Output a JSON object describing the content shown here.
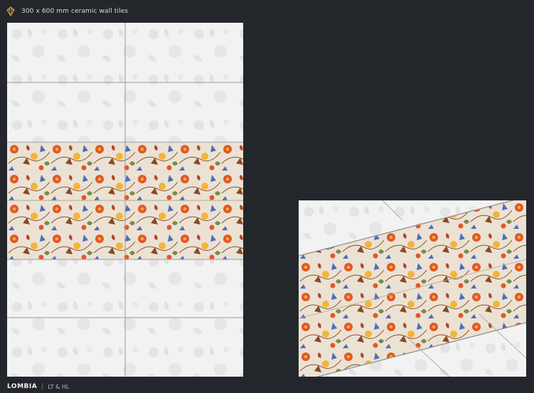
{
  "header": {
    "logo_icon": "diamond-brand-logo-icon",
    "spec_text": "300 x 600 mm ceramic wall tiles"
  },
  "footer": {
    "series_name": "LOMBIA",
    "separator": "|",
    "tile_codes": "LT & HL"
  },
  "colors": {
    "background": "#23272c",
    "light_tile": "#f2f2f2",
    "grout": "#9a9a9a",
    "decor_base": "#ebe2d4",
    "flower_orange": "#e2572a",
    "flower_yellow": "#f2b53a",
    "flower_blue": "#4d6fb8",
    "leaf_brown": "#8a4a22",
    "leaf_green": "#7c8a4a"
  }
}
